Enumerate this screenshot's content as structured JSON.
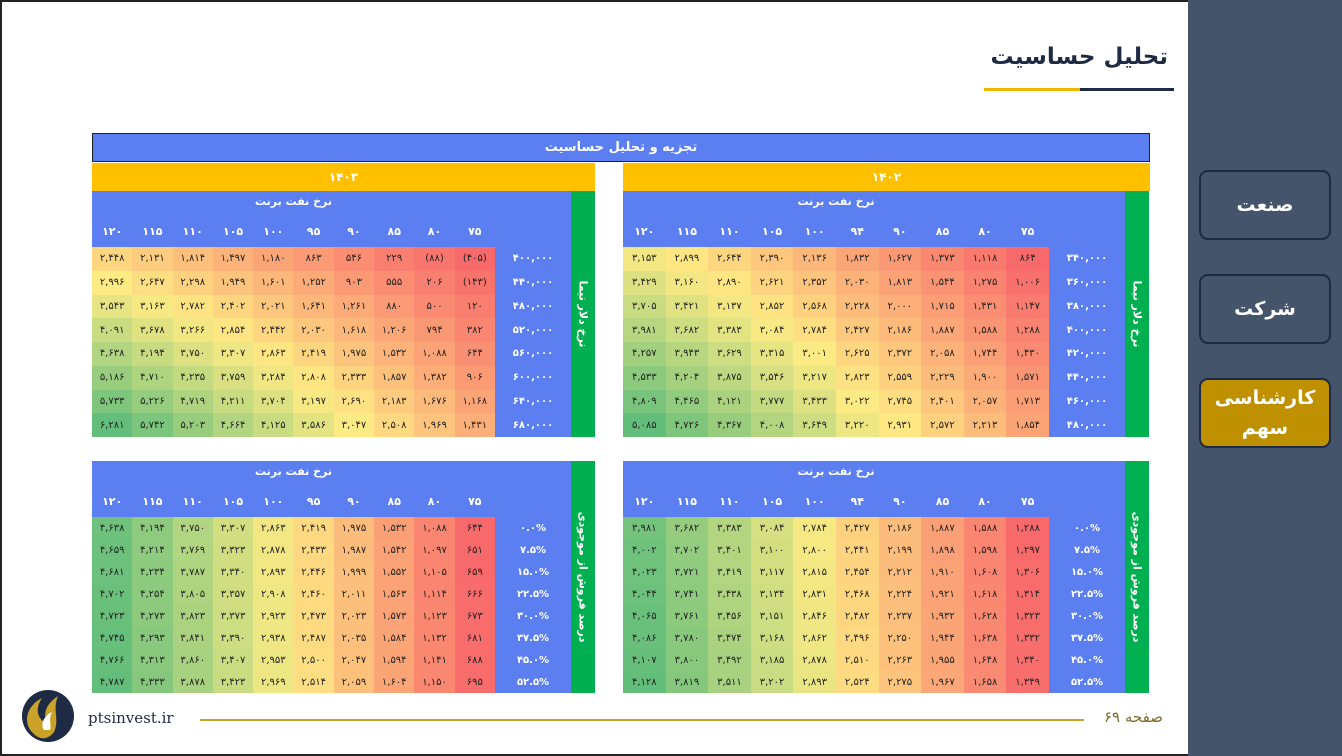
{
  "title": "تحلیل حساسیت",
  "sidebar": {
    "items": [
      {
        "label": "صنعت",
        "active": false
      },
      {
        "label": "شرکت",
        "active": false
      },
      {
        "label": "کارشناسی سهم",
        "active": true
      }
    ]
  },
  "table": {
    "title": "تجزیه و تحلیل حساسیت",
    "year_left": "۱۴۰۳",
    "year_right": "۱۴۰۲",
    "blocks": [
      {
        "id": "right-top",
        "oil_header": "نرخ نفت برنت",
        "side_header": "نرخ دلار نیما",
        "cols": [
          "۷۵",
          "۸۰",
          "۸۵",
          "۹۰",
          "۹۴",
          "۱۰۰",
          "۱۰۵",
          "۱۱۰",
          "۱۱۵",
          "۱۲۰"
        ],
        "rows": [
          "۳۴۰,۰۰۰",
          "۳۶۰,۰۰۰",
          "۳۸۰,۰۰۰",
          "۴۰۰,۰۰۰",
          "۴۲۰,۰۰۰",
          "۴۴۰,۰۰۰",
          "۴۶۰,۰۰۰",
          "۴۸۰,۰۰۰"
        ],
        "cells": [
          [
            "۸۶۴",
            "۱,۱۱۸",
            "۱,۳۷۳",
            "۱,۶۲۷",
            "۱,۸۳۲",
            "۲,۱۳۶",
            "۲,۳۹۰",
            "۲,۶۴۴",
            "۲,۸۹۹",
            "۳,۱۵۳"
          ],
          [
            "۱,۰۰۶",
            "۱,۲۷۵",
            "۱,۵۴۴",
            "۱,۸۱۳",
            "۲,۰۳۰",
            "۲,۳۵۲",
            "۲,۶۲۱",
            "۲,۸۹۰",
            "۳,۱۶۰",
            "۳,۴۲۹"
          ],
          [
            "۱,۱۴۷",
            "۱,۴۳۱",
            "۱,۷۱۵",
            "۲,۰۰۰",
            "۲,۲۲۸",
            "۲,۵۶۸",
            "۲,۸۵۲",
            "۳,۱۳۷",
            "۳,۴۲۱",
            "۳,۷۰۵"
          ],
          [
            "۱,۲۸۸",
            "۱,۵۸۸",
            "۱,۸۸۷",
            "۲,۱۸۶",
            "۲,۴۲۷",
            "۲,۷۸۴",
            "۳,۰۸۴",
            "۳,۳۸۳",
            "۳,۶۸۲",
            "۳,۹۸۱"
          ],
          [
            "۱,۴۳۰",
            "۱,۷۴۴",
            "۲,۰۵۸",
            "۲,۳۷۲",
            "۲,۶۲۵",
            "۳,۰۰۱",
            "۳,۳۱۵",
            "۳,۶۲۹",
            "۳,۹۴۳",
            "۴,۲۵۷"
          ],
          [
            "۱,۵۷۱",
            "۱,۹۰۰",
            "۲,۲۲۹",
            "۲,۵۵۹",
            "۲,۸۲۳",
            "۳,۲۱۷",
            "۳,۵۴۶",
            "۳,۸۷۵",
            "۴,۲۰۴",
            "۴,۵۳۳"
          ],
          [
            "۱,۷۱۳",
            "۲,۰۵۷",
            "۲,۴۰۱",
            "۲,۷۴۵",
            "۳,۰۲۲",
            "۳,۴۳۳",
            "۳,۷۷۷",
            "۴,۱۲۱",
            "۴,۴۶۵",
            "۴,۸۰۹"
          ],
          [
            "۱,۸۵۴",
            "۲,۲۱۳",
            "۲,۵۷۲",
            "۲,۹۳۱",
            "۳,۲۲۰",
            "۳,۶۴۹",
            "۴,۰۰۸",
            "۴,۳۶۷",
            "۴,۷۲۶",
            "۵,۰۸۵"
          ]
        ],
        "shade": [
          [
            0.0,
            0.06,
            0.12,
            0.18,
            0.23,
            0.3,
            0.36,
            0.42,
            0.48,
            0.54
          ],
          [
            0.03,
            0.1,
            0.16,
            0.22,
            0.28,
            0.35,
            0.41,
            0.48,
            0.54,
            0.61
          ],
          [
            0.07,
            0.14,
            0.2,
            0.27,
            0.32,
            0.4,
            0.47,
            0.54,
            0.6,
            0.67
          ],
          [
            0.1,
            0.17,
            0.24,
            0.31,
            0.37,
            0.45,
            0.52,
            0.59,
            0.66,
            0.73
          ],
          [
            0.13,
            0.21,
            0.28,
            0.36,
            0.42,
            0.51,
            0.58,
            0.66,
            0.73,
            0.8
          ],
          [
            0.17,
            0.25,
            0.32,
            0.4,
            0.46,
            0.56,
            0.63,
            0.71,
            0.79,
            0.87
          ],
          [
            0.2,
            0.28,
            0.36,
            0.45,
            0.51,
            0.61,
            0.69,
            0.77,
            0.85,
            0.93
          ],
          [
            0.23,
            0.32,
            0.4,
            0.49,
            0.56,
            0.66,
            0.74,
            0.83,
            0.91,
            1.0
          ]
        ]
      },
      {
        "id": "left-top",
        "oil_header": "نرخ نفت برنت",
        "side_header": "نرخ دلار نیما",
        "cols": [
          "۷۵",
          "۸۰",
          "۸۵",
          "۹۰",
          "۹۵",
          "۱۰۰",
          "۱۰۵",
          "۱۱۰",
          "۱۱۵",
          "۱۲۰"
        ],
        "rows": [
          "۴۰۰,۰۰۰",
          "۴۴۰,۰۰۰",
          "۴۸۰,۰۰۰",
          "۵۲۰,۰۰۰",
          "۵۶۰,۰۰۰",
          "۶۰۰,۰۰۰",
          "۶۴۰,۰۰۰",
          "۶۸۰,۰۰۰"
        ],
        "cells": [
          [
            "(۴۰۵)",
            "(۸۸)",
            "۲۲۹",
            "۵۴۶",
            "۸۶۳",
            "۱,۱۸۰",
            "۱,۴۹۷",
            "۱,۸۱۴",
            "۲,۱۳۱",
            "۲,۴۴۸"
          ],
          [
            "(۱۴۳)",
            "۲۰۶",
            "۵۵۵",
            "۹۰۳",
            "۱,۲۵۲",
            "۱,۶۰۱",
            "۱,۹۴۹",
            "۲,۲۹۸",
            "۲,۶۴۷",
            "۲,۹۹۶"
          ],
          [
            "۱۲۰",
            "۵۰۰",
            "۸۸۰",
            "۱,۲۶۱",
            "۱,۶۴۱",
            "۲,۰۲۱",
            "۲,۴۰۲",
            "۲,۷۸۲",
            "۳,۱۶۳",
            "۳,۵۴۳"
          ],
          [
            "۳۸۲",
            "۷۹۴",
            "۱,۲۰۶",
            "۱,۶۱۸",
            "۲,۰۳۰",
            "۲,۴۴۲",
            "۲,۸۵۴",
            "۳,۲۶۶",
            "۳,۶۷۸",
            "۴,۰۹۱"
          ],
          [
            "۶۴۴",
            "۱,۰۸۸",
            "۱,۵۳۲",
            "۱,۹۷۵",
            "۲,۴۱۹",
            "۲,۸۶۳",
            "۳,۳۰۷",
            "۳,۷۵۰",
            "۴,۱۹۴",
            "۴,۶۳۸"
          ],
          [
            "۹۰۶",
            "۱,۳۸۲",
            "۱,۸۵۷",
            "۲,۳۳۳",
            "۲,۸۰۸",
            "۳,۲۸۴",
            "۳,۷۵۹",
            "۴,۲۳۵",
            "۴,۷۱۰",
            "۵,۱۸۶"
          ],
          [
            "۱,۱۶۸",
            "۱,۶۷۶",
            "۲,۱۸۳",
            "۲,۶۹۰",
            "۳,۱۹۷",
            "۳,۷۰۴",
            "۴,۲۱۱",
            "۴,۷۱۹",
            "۵,۲۲۶",
            "۵,۷۳۳"
          ],
          [
            "۱,۴۳۱",
            "۱,۹۶۹",
            "۲,۵۰۸",
            "۳,۰۴۷",
            "۳,۵۸۶",
            "۴,۱۲۵",
            "۴,۶۶۴",
            "۵,۲۰۳",
            "۵,۷۴۲",
            "۶,۲۸۱"
          ]
        ],
        "shade": [
          [
            0.0,
            0.05,
            0.09,
            0.14,
            0.19,
            0.23,
            0.28,
            0.33,
            0.38,
            0.42
          ],
          [
            0.04,
            0.09,
            0.14,
            0.19,
            0.25,
            0.3,
            0.35,
            0.4,
            0.45,
            0.5
          ],
          [
            0.08,
            0.13,
            0.19,
            0.25,
            0.3,
            0.36,
            0.42,
            0.47,
            0.53,
            0.58
          ],
          [
            0.11,
            0.18,
            0.24,
            0.3,
            0.36,
            0.42,
            0.48,
            0.54,
            0.6,
            0.67
          ],
          [
            0.15,
            0.22,
            0.29,
            0.35,
            0.42,
            0.48,
            0.55,
            0.61,
            0.68,
            0.75
          ],
          [
            0.19,
            0.26,
            0.34,
            0.41,
            0.48,
            0.55,
            0.62,
            0.69,
            0.76,
            0.83
          ],
          [
            0.23,
            0.31,
            0.38,
            0.46,
            0.53,
            0.61,
            0.68,
            0.76,
            0.84,
            0.91
          ],
          [
            0.27,
            0.35,
            0.43,
            0.51,
            0.59,
            0.67,
            0.75,
            0.83,
            0.92,
            1.0
          ]
        ]
      },
      {
        "id": "right-bottom",
        "oil_header": "نرخ نفت برنت",
        "side_header": "درصد فروش از موجودی",
        "cols": [
          "۷۵",
          "۸۰",
          "۸۵",
          "۹۰",
          "۹۴",
          "۱۰۰",
          "۱۰۵",
          "۱۱۰",
          "۱۱۵",
          "۱۲۰"
        ],
        "rows": [
          "۰.۰%",
          "۷.۵%",
          "۱۵.۰%",
          "۲۲.۵%",
          "۳۰.۰%",
          "۳۷.۵%",
          "۴۵.۰%",
          "۵۲.۵%"
        ],
        "cells": [
          [
            "۱,۲۸۸",
            "۱,۵۸۸",
            "۱,۸۸۷",
            "۲,۱۸۶",
            "۲,۴۲۷",
            "۲,۷۸۴",
            "۳,۰۸۴",
            "۳,۳۸۳",
            "۳,۶۸۲",
            "۳,۹۸۱"
          ],
          [
            "۱,۲۹۷",
            "۱,۵۹۸",
            "۱,۸۹۸",
            "۲,۱۹۹",
            "۲,۴۴۱",
            "۲,۸۰۰",
            "۳,۱۰۰",
            "۳,۴۰۱",
            "۳,۷۰۲",
            "۴,۰۰۲"
          ],
          [
            "۱,۳۰۶",
            "۱,۶۰۸",
            "۱,۹۱۰",
            "۲,۲۱۲",
            "۲,۴۵۴",
            "۲,۸۱۵",
            "۳,۱۱۷",
            "۳,۴۱۹",
            "۳,۷۲۱",
            "۴,۰۲۳"
          ],
          [
            "۱,۳۱۴",
            "۱,۶۱۸",
            "۱,۹۲۱",
            "۲,۲۲۴",
            "۲,۴۶۸",
            "۲,۸۳۱",
            "۳,۱۳۴",
            "۳,۴۳۸",
            "۳,۷۴۱",
            "۴,۰۴۴"
          ],
          [
            "۱,۳۲۳",
            "۱,۶۲۸",
            "۱,۹۳۲",
            "۲,۲۳۷",
            "۲,۴۸۲",
            "۲,۸۴۶",
            "۳,۱۵۱",
            "۳,۴۵۶",
            "۳,۷۶۱",
            "۴,۰۶۵"
          ],
          [
            "۱,۳۳۲",
            "۱,۶۳۸",
            "۱,۹۴۴",
            "۲,۲۵۰",
            "۲,۴۹۶",
            "۲,۸۶۲",
            "۳,۱۶۸",
            "۳,۴۷۴",
            "۳,۷۸۰",
            "۴,۰۸۶"
          ],
          [
            "۱,۳۴۰",
            "۱,۶۴۸",
            "۱,۹۵۵",
            "۲,۲۶۳",
            "۲,۵۱۰",
            "۲,۸۷۸",
            "۳,۱۸۵",
            "۳,۴۹۲",
            "۳,۸۰۰",
            "۴,۱۰۷"
          ],
          [
            "۱,۳۴۹",
            "۱,۶۵۸",
            "۱,۹۶۷",
            "۲,۲۷۵",
            "۲,۵۲۴",
            "۲,۸۹۳",
            "۳,۲۰۲",
            "۳,۵۱۱",
            "۳,۸۱۹",
            "۴,۱۲۸"
          ]
        ],
        "shade": [
          [
            0.0,
            0.11,
            0.21,
            0.32,
            0.4,
            0.53,
            0.63,
            0.74,
            0.84,
            0.95
          ],
          [
            0.0,
            0.11,
            0.21,
            0.32,
            0.41,
            0.53,
            0.64,
            0.74,
            0.85,
            0.96
          ],
          [
            0.01,
            0.11,
            0.22,
            0.32,
            0.41,
            0.54,
            0.64,
            0.75,
            0.86,
            0.96
          ],
          [
            0.01,
            0.12,
            0.22,
            0.33,
            0.42,
            0.54,
            0.65,
            0.76,
            0.86,
            0.97
          ],
          [
            0.01,
            0.12,
            0.23,
            0.33,
            0.42,
            0.55,
            0.66,
            0.76,
            0.87,
            0.98
          ],
          [
            0.02,
            0.12,
            0.23,
            0.34,
            0.43,
            0.55,
            0.66,
            0.77,
            0.88,
            0.98
          ],
          [
            0.02,
            0.13,
            0.23,
            0.34,
            0.43,
            0.56,
            0.67,
            0.78,
            0.88,
            0.99
          ],
          [
            0.02,
            0.13,
            0.24,
            0.35,
            0.44,
            0.57,
            0.67,
            0.78,
            0.89,
            1.0
          ]
        ]
      },
      {
        "id": "left-bottom",
        "oil_header": "نرخ نفت برنت",
        "side_header": "درصد فروش از موجودی",
        "cols": [
          "۷۵",
          "۸۰",
          "۸۵",
          "۹۰",
          "۹۵",
          "۱۰۰",
          "۱۰۵",
          "۱۱۰",
          "۱۱۵",
          "۱۲۰"
        ],
        "rows": [
          "۰.۰%",
          "۷.۵%",
          "۱۵.۰%",
          "۲۲.۵%",
          "۳۰.۰%",
          "۳۷.۵%",
          "۴۵.۰%",
          "۵۲.۵%"
        ],
        "cells": [
          [
            "۶۴۴",
            "۱,۰۸۸",
            "۱,۵۳۲",
            "۱,۹۷۵",
            "۲,۴۱۹",
            "۲,۸۶۳",
            "۳,۳۰۷",
            "۳,۷۵۰",
            "۴,۱۹۴",
            "۴,۶۳۸"
          ],
          [
            "۶۵۱",
            "۱,۰۹۷",
            "۱,۵۴۲",
            "۱,۹۸۷",
            "۲,۴۳۳",
            "۲,۸۷۸",
            "۳,۳۲۳",
            "۳,۷۶۹",
            "۴,۲۱۴",
            "۴,۶۵۹"
          ],
          [
            "۶۵۹",
            "۱,۱۰۵",
            "۱,۵۵۲",
            "۱,۹۹۹",
            "۲,۴۴۶",
            "۲,۸۹۳",
            "۳,۳۴۰",
            "۳,۷۸۷",
            "۴,۲۳۴",
            "۴,۶۸۱"
          ],
          [
            "۶۶۶",
            "۱,۱۱۴",
            "۱,۵۶۳",
            "۲,۰۱۱",
            "۲,۴۶۰",
            "۲,۹۰۸",
            "۳,۳۵۷",
            "۳,۸۰۵",
            "۴,۲۵۴",
            "۴,۷۰۲"
          ],
          [
            "۶۷۳",
            "۱,۱۲۳",
            "۱,۵۷۳",
            "۲,۰۲۳",
            "۲,۴۷۳",
            "۲,۹۲۳",
            "۳,۳۷۳",
            "۳,۸۲۳",
            "۴,۲۷۳",
            "۴,۷۲۳"
          ],
          [
            "۶۸۱",
            "۱,۱۳۲",
            "۱,۵۸۴",
            "۲,۰۳۵",
            "۲,۴۸۷",
            "۲,۹۳۸",
            "۳,۳۹۰",
            "۳,۸۴۱",
            "۴,۲۹۳",
            "۴,۷۴۵"
          ],
          [
            "۶۸۸",
            "۱,۱۴۱",
            "۱,۵۹۴",
            "۲,۰۴۷",
            "۲,۵۰۰",
            "۲,۹۵۳",
            "۳,۴۰۷",
            "۳,۸۶۰",
            "۴,۳۱۳",
            "۴,۷۶۶"
          ],
          [
            "۶۹۵",
            "۱,۱۵۰",
            "۱,۶۰۴",
            "۲,۰۵۹",
            "۲,۵۱۴",
            "۲,۹۶۹",
            "۳,۴۲۳",
            "۳,۸۷۸",
            "۴,۳۳۳",
            "۴,۷۸۷"
          ]
        ],
        "shade": [
          [
            0.0,
            0.11,
            0.21,
            0.32,
            0.43,
            0.54,
            0.64,
            0.75,
            0.86,
            0.96
          ],
          [
            0.0,
            0.11,
            0.22,
            0.32,
            0.43,
            0.54,
            0.65,
            0.75,
            0.86,
            0.97
          ],
          [
            0.0,
            0.11,
            0.22,
            0.33,
            0.43,
            0.54,
            0.65,
            0.76,
            0.87,
            0.97
          ],
          [
            0.01,
            0.11,
            0.22,
            0.33,
            0.44,
            0.55,
            0.65,
            0.76,
            0.87,
            0.98
          ],
          [
            0.01,
            0.12,
            0.22,
            0.33,
            0.44,
            0.55,
            0.66,
            0.77,
            0.87,
            0.98
          ],
          [
            0.01,
            0.12,
            0.23,
            0.33,
            0.44,
            0.55,
            0.66,
            0.77,
            0.88,
            0.99
          ],
          [
            0.01,
            0.12,
            0.23,
            0.34,
            0.45,
            0.56,
            0.67,
            0.78,
            0.88,
            0.99
          ],
          [
            0.01,
            0.12,
            0.23,
            0.34,
            0.45,
            0.56,
            0.67,
            0.78,
            0.89,
            1.0
          ]
        ]
      }
    ]
  },
  "footer": {
    "page": "صفحه ۶۹",
    "site": "ptsinvest.ir"
  },
  "colors": {
    "sidebar": "#44546a",
    "active": "#bf9000",
    "header_blue": "#5b7ff0",
    "year_band": "#ffc000",
    "side_green": "#00b050",
    "scale_low": "#f8696b",
    "scale_mid": "#ffeb84",
    "scale_high": "#63be7b"
  }
}
